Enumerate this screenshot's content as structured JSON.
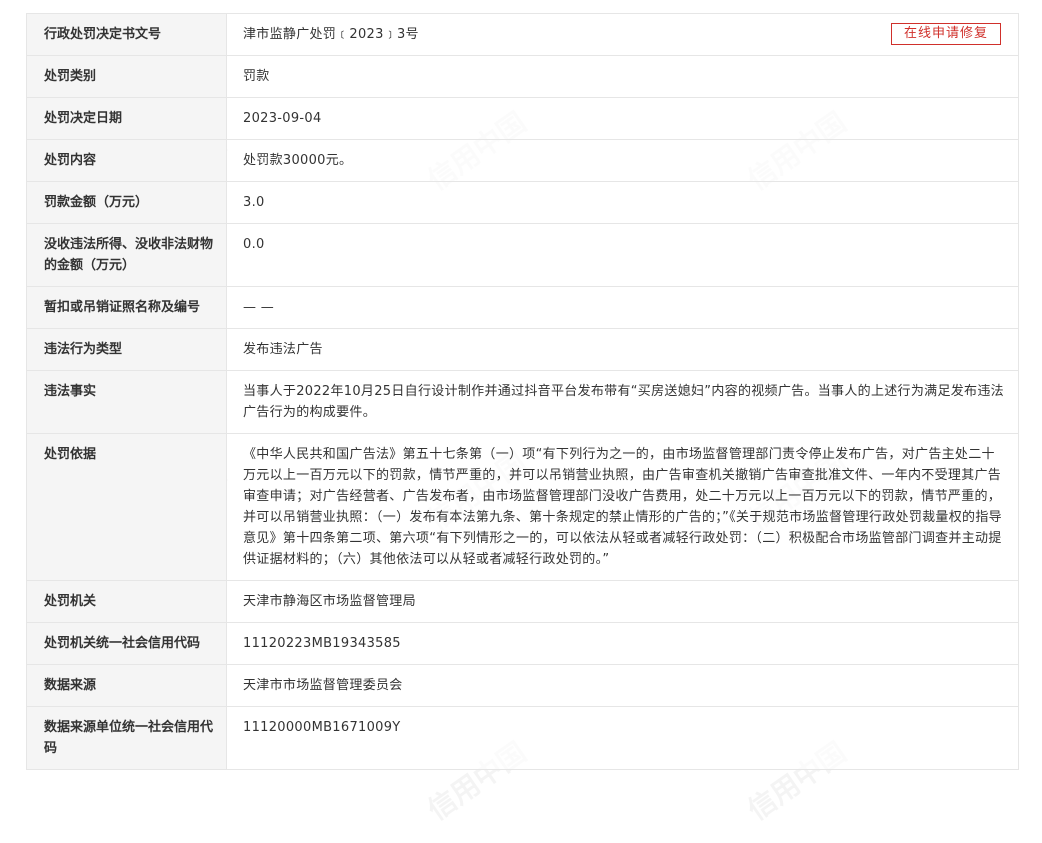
{
  "repair_button_label": "在线申请修复",
  "rows": [
    {
      "label": "行政处罚决定书文号",
      "value": "津市监静广处罚﹝2023﹞3号"
    },
    {
      "label": "处罚类别",
      "value": "罚款"
    },
    {
      "label": "处罚决定日期",
      "value": "2023-09-04"
    },
    {
      "label": "处罚内容",
      "value": "处罚款30000元。"
    },
    {
      "label": "罚款金额（万元）",
      "value": "3.0"
    },
    {
      "label": "没收违法所得、没收非法财物的金额（万元）",
      "value": "0.0"
    },
    {
      "label": "暂扣或吊销证照名称及编号",
      "value": "— —"
    },
    {
      "label": "违法行为类型",
      "value": "发布违法广告"
    },
    {
      "label": "违法事实",
      "value": "当事人于2022年10月25日自行设计制作并通过抖音平台发布带有“买房送媳妇”内容的视频广告。当事人的上述行为满足发布违法广告行为的构成要件。"
    },
    {
      "label": "处罚依据",
      "value": "《中华人民共和国广告法》第五十七条第（一）项“有下列行为之一的，由市场监督管理部门责令停止发布广告，对广告主处二十万元以上一百万元以下的罚款，情节严重的，并可以吊销营业执照，由广告审查机关撤销广告审查批准文件、一年内不受理其广告审查申请；对广告经营者、广告发布者，由市场监督管理部门没收广告费用，处二十万元以上一百万元以下的罚款，情节严重的，并可以吊销营业执照：（一）发布有本法第九条、第十条规定的禁止情形的广告的；”《关于规范市场监督管理行政处罚裁量权的指导意见》第十四条第二项、第六项“有下列情形之一的，可以依法从轻或者减轻行政处罚：（二）积极配合市场监管部门调查并主动提供证据材料的；（六）其他依法可以从轻或者减轻行政处罚的。”"
    },
    {
      "label": "处罚机关",
      "value": "天津市静海区市场监督管理局"
    },
    {
      "label": "处罚机关统一社会信用代码",
      "value": "11120223MB19343585"
    },
    {
      "label": "数据来源",
      "value": "天津市市场监督管理委员会"
    },
    {
      "label": "数据来源单位统一社会信用代码",
      "value": "11120000MB1671009Y"
    }
  ],
  "watermark_text": "信用中国",
  "accent_color": "#d0302b"
}
